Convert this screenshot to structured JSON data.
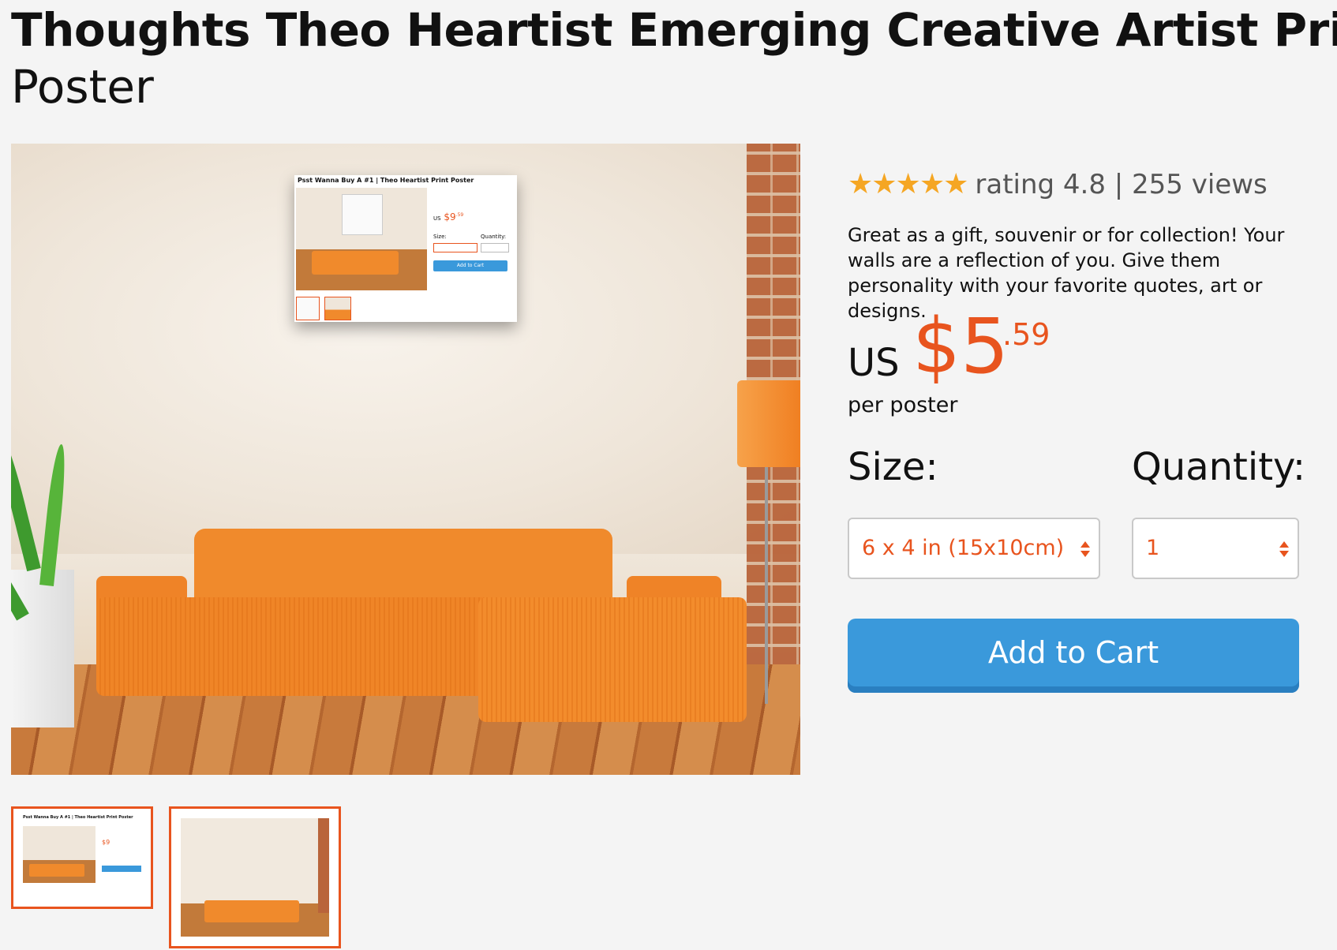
{
  "product": {
    "title_bold": "Thoughts Theo Heartist Emerging Creative Artist Print",
    "title_light": "Poster"
  },
  "rating": {
    "stars": "★★★★★",
    "text": "rating 4.8 | 255 views",
    "value": 4.8,
    "views": 255
  },
  "description": "Great as a gift, souvenir or for collection! Your walls are a reflection of you. Give them personality with your favorite quotes, art or designs.",
  "price": {
    "currency": "US",
    "whole": "$5",
    "cents": ".59",
    "per": "per poster"
  },
  "size": {
    "label": "Size:",
    "selected": "6 x 4 in (15x10cm)"
  },
  "quantity": {
    "label": "Quantity:",
    "selected": "1"
  },
  "cart": {
    "label": "Add to Cart"
  },
  "poster_preview": {
    "title": "Psst Wanna Buy A #1 | Theo Heartist Print Poster",
    "price": "$9",
    "price_cents": ".59",
    "currency": "US",
    "size_label": "Size:",
    "qty_label": "Quantity:",
    "button": "Add to Cart"
  },
  "thumbnails": {
    "count": 2,
    "selected_index": 1
  },
  "colors": {
    "accent": "#e8541e",
    "button": "#3a99db",
    "stars": "#f5a623",
    "background": "#f4f4f4"
  }
}
